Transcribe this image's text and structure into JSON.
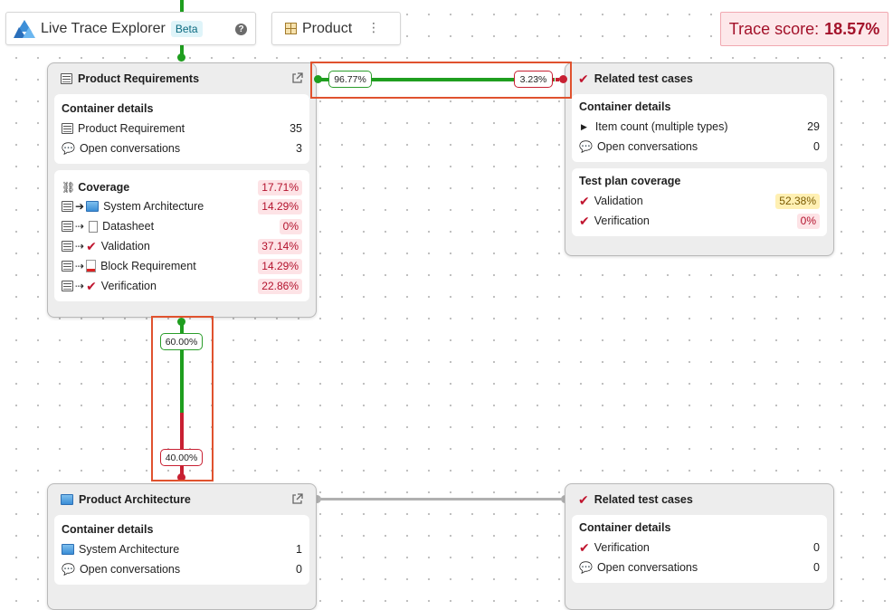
{
  "header": {
    "app_title": "Live Trace Explorer",
    "badge": "Beta",
    "help_icon": "?",
    "product_label": "Product",
    "menu_icon": "⋮",
    "trace_score_label": "Trace score:",
    "trace_score_value": "18.57%"
  },
  "colors": {
    "green": "#1f9e1f",
    "red": "#c82032",
    "gray": "#b0b0b0",
    "score_bg": "#fde8ea"
  },
  "cards": {
    "product_requirements": {
      "title": "Product Requirements",
      "details_title": "Container details",
      "details": [
        {
          "label": "Product Requirement",
          "value": "35",
          "icon": "table-icon"
        },
        {
          "label": "Open conversations",
          "value": "3",
          "icon": "chat-icon"
        }
      ],
      "coverage_title": "Coverage",
      "coverage_value": "17.71%",
      "coverage": [
        {
          "label": "System Architecture",
          "value": "14.29%",
          "icon": "architecture-icon",
          "link": "solid"
        },
        {
          "label": "Datasheet",
          "value": "0%",
          "icon": "datasheet-icon",
          "link": "dashed"
        },
        {
          "label": "Validation",
          "value": "37.14%",
          "icon": "check-icon",
          "link": "dashed"
        },
        {
          "label": "Block Requirement",
          "value": "14.29%",
          "icon": "block-requirement-icon",
          "link": "dashed"
        },
        {
          "label": "Verification",
          "value": "22.86%",
          "icon": "check-icon",
          "link": "dashed"
        }
      ]
    },
    "related_tests_1": {
      "title": "Related test cases",
      "details_title": "Container details",
      "details": [
        {
          "label": "Item count (multiple types)",
          "value": "29"
        },
        {
          "label": "Open conversations",
          "value": "0"
        }
      ],
      "plan_title": "Test plan coverage",
      "plan": [
        {
          "label": "Validation",
          "value": "52.38%",
          "tone": "yellow"
        },
        {
          "label": "Verification",
          "value": "0%",
          "tone": "red"
        }
      ]
    },
    "product_architecture": {
      "title": "Product Architecture",
      "details_title": "Container details",
      "details": [
        {
          "label": "System Architecture",
          "value": "1"
        },
        {
          "label": "Open conversations",
          "value": "0"
        }
      ]
    },
    "related_tests_2": {
      "title": "Related test cases",
      "details_title": "Container details",
      "details": [
        {
          "label": "Verification",
          "value": "0"
        },
        {
          "label": "Open conversations",
          "value": "0"
        }
      ]
    }
  },
  "links": {
    "horizontal": {
      "covered": "96.77%",
      "uncovered": "3.23%",
      "covered_fraction": 0.9677
    },
    "vertical": {
      "covered": "60.00%",
      "uncovered": "40.00%",
      "covered_fraction": 0.6
    }
  }
}
